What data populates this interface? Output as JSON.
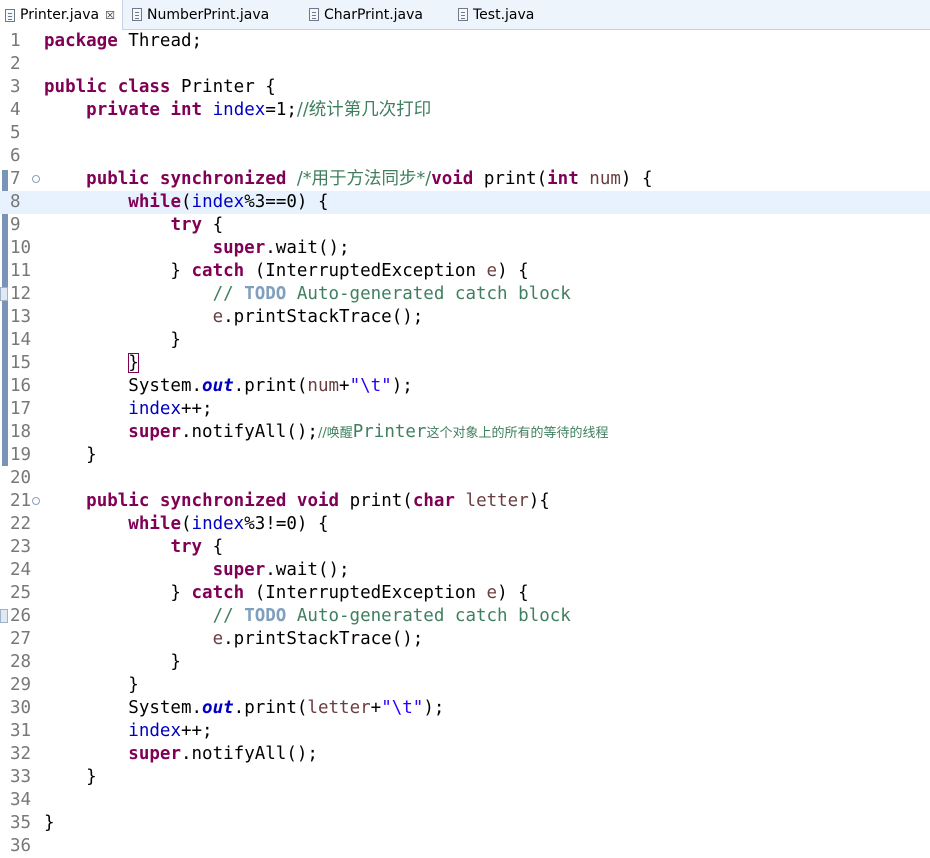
{
  "tabs": [
    {
      "label": "Printer.java",
      "active": true,
      "closable": true,
      "icon": "java-file-icon"
    },
    {
      "label": "NumberPrint.java",
      "active": false,
      "icon": "java-file-icon"
    },
    {
      "label": "CharPrint.java",
      "active": false,
      "icon": "java-file-icon"
    },
    {
      "label": "Test.java",
      "active": false,
      "icon": "java-file-icon"
    }
  ],
  "close_glyph": "☒",
  "line_numbers": [
    "1",
    "2",
    "3",
    "4",
    "5",
    "6",
    "7",
    "8",
    "9",
    "10",
    "11",
    "12",
    "13",
    "14",
    "15",
    "16",
    "17",
    "18",
    "19",
    "20",
    "21",
    "22",
    "23",
    "24",
    "25",
    "26",
    "27",
    "28",
    "29",
    "30",
    "31",
    "32",
    "33",
    "34",
    "35",
    "36"
  ],
  "current_line": 8,
  "fold_glyph": "⊖",
  "colors": {
    "keyword": "#7f0055",
    "field": "#0000c0",
    "string": "#2a00ff",
    "comment": "#3f7f5f",
    "todo": "#7f9fbf",
    "current_line_bg": "#e8f2fe"
  },
  "code": {
    "l1": [
      "package",
      " Thread;"
    ],
    "l3": [
      "public",
      " ",
      "class",
      " Printer {"
    ],
    "l4": [
      "    ",
      "private",
      " ",
      "int",
      " ",
      "index",
      "=1;",
      "//统计第几次打印"
    ],
    "l7": [
      "    ",
      "public",
      " ",
      "synchronized",
      " ",
      "/*用于方法同步*/",
      "void",
      " print(",
      "int",
      " ",
      "num",
      ") {"
    ],
    "l8": [
      "        ",
      "while",
      "(",
      "index",
      "%3==0) {"
    ],
    "l9": [
      "            ",
      "try",
      " {"
    ],
    "l10": [
      "                ",
      "super",
      ".wait();"
    ],
    "l11": [
      "            } ",
      "catch",
      " (InterruptedException ",
      "e",
      ") {"
    ],
    "l12": [
      "                ",
      "// ",
      "TODO",
      " Auto-generated catch block"
    ],
    "l13": [
      "                ",
      "e",
      ".printStackTrace();"
    ],
    "l14": [
      "            }"
    ],
    "l15": [
      "        ",
      "}"
    ],
    "l16": [
      "        System.",
      "out",
      ".print(",
      "num",
      "+",
      "\"\\t\"",
      ");"
    ],
    "l17": [
      "        ",
      "index",
      "++;"
    ],
    "l18": [
      "        ",
      "super",
      ".notifyAll();",
      "//唤醒",
      "Printer",
      "这个对象上的所有的等待的线程"
    ],
    "l19": [
      "    }"
    ],
    "l21": [
      "    ",
      "public",
      " ",
      "synchronized",
      " ",
      "void",
      " print(",
      "char",
      " ",
      "letter",
      "){"
    ],
    "l22": [
      "        ",
      "while",
      "(",
      "index",
      "%3!=0) {"
    ],
    "l23": [
      "            ",
      "try",
      " {"
    ],
    "l24": [
      "                ",
      "super",
      ".wait();"
    ],
    "l25": [
      "            } ",
      "catch",
      " (InterruptedException ",
      "e",
      ") {"
    ],
    "l26": [
      "                ",
      "// ",
      "TODO",
      " Auto-generated catch block"
    ],
    "l27": [
      "                ",
      "e",
      ".printStackTrace();"
    ],
    "l28": [
      "            }"
    ],
    "l29": [
      "        }"
    ],
    "l30": [
      "        System.",
      "out",
      ".print(",
      "letter",
      "+",
      "\"\\t\"",
      ");"
    ],
    "l31": [
      "        ",
      "index",
      "++;"
    ],
    "l32": [
      "        ",
      "super",
      ".notifyAll();"
    ],
    "l33": [
      "    }"
    ],
    "l35": [
      "}"
    ]
  }
}
